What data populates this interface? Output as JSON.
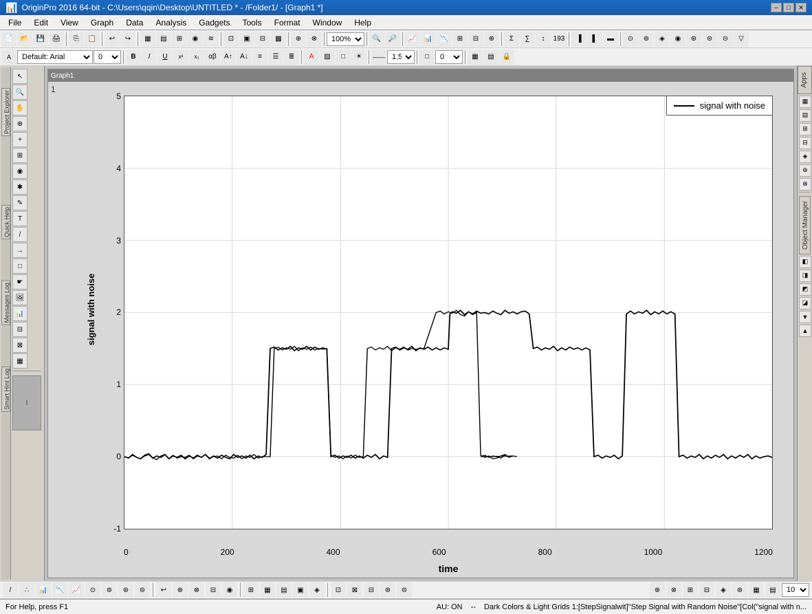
{
  "window": {
    "title": "OriginPro 2016 64-bit - C:\\Users\\qqin\\Desktop\\UNTITLED * - /Folder1/ - [Graph1 *]",
    "app_icon": "📊"
  },
  "menu": {
    "items": [
      "File",
      "Edit",
      "View",
      "Graph",
      "Data",
      "Analysis",
      "Gadgets",
      "Tools",
      "Format",
      "Window",
      "Help"
    ]
  },
  "toolbar": {
    "zoom_value": "100%",
    "font_name": "Default: Arial",
    "font_size": "0",
    "line_width": "1.5",
    "number_field": "0"
  },
  "graph": {
    "title": "Graph1",
    "page_num": "1",
    "y_label": "signal with noise",
    "x_label": "time",
    "legend_text": "signal with noise",
    "y_axis": {
      "min": -1,
      "max": 5,
      "ticks": [
        -1,
        0,
        1,
        2,
        3,
        4,
        5
      ]
    },
    "x_axis": {
      "min": 0,
      "max": 1200,
      "ticks": [
        0,
        200,
        400,
        600,
        800,
        1000,
        1200
      ]
    }
  },
  "status_bar": {
    "help_text": "For Help, press F1",
    "au_text": "AU: ON",
    "info_text": "Dark Colors & Light Grids  1:[StepSignalwit]\"Step Signal with Random Noise\"[Col(\"signal with n..."
  },
  "panels": {
    "apps_label": "Apps",
    "object_manager_label": "Object Manager",
    "project_explorer_label": "Project Explorer",
    "quick_help_label": "Quick Help",
    "messages_log_label": "Messages Log",
    "smart_hint_label": "Smart Hint Log"
  },
  "bottom_toolbar": {
    "page_num_field": "10"
  }
}
